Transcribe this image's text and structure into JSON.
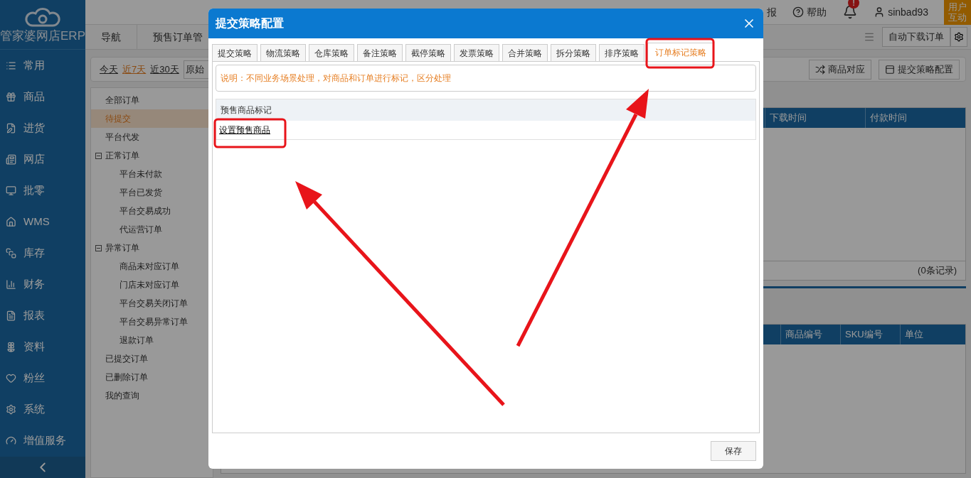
{
  "app": {
    "logo_text": "管家婆网店ERP"
  },
  "sidebar": {
    "items": [
      {
        "label": "常用"
      },
      {
        "label": "商品"
      },
      {
        "label": "进货"
      },
      {
        "label": "网店"
      },
      {
        "label": "批零"
      },
      {
        "label": "WMS"
      },
      {
        "label": "库存"
      },
      {
        "label": "财务"
      },
      {
        "label": "报表"
      },
      {
        "label": "资料"
      },
      {
        "label": "粉丝"
      },
      {
        "label": "系统"
      },
      {
        "label": "增值服务"
      }
    ]
  },
  "top_bar": {
    "partial_text": "报",
    "help": "帮助",
    "notification_badge": "!",
    "username": "sinbad93",
    "user_interact": "用户互动"
  },
  "nav_tabs": [
    {
      "label": "导航"
    },
    {
      "label": "预售订单管"
    }
  ],
  "toolbar": {
    "button": "自动下载订单"
  },
  "date_filters": [
    {
      "label": "今天",
      "selected": false
    },
    {
      "label": "近7天",
      "selected": true
    },
    {
      "label": "近30天",
      "selected": false
    }
  ],
  "filter_select": {
    "value": "原始"
  },
  "action_buttons": [
    "商品对应",
    "提交策略配置"
  ],
  "tree": [
    {
      "label": "全部订单",
      "selected": false
    },
    {
      "label": "待提交",
      "selected": true
    },
    {
      "label": "平台代发",
      "selected": false
    },
    {
      "label": "正常订单",
      "selected": false,
      "expanded": true,
      "children": [
        {
          "label": "平台未付款",
          "selected": false
        },
        {
          "label": "平台已发货",
          "selected": false
        },
        {
          "label": "平台交易成功",
          "selected": false
        },
        {
          "label": "代运营订单",
          "selected": false
        }
      ]
    },
    {
      "label": "异常订单",
      "selected": false,
      "expanded": true,
      "children": [
        {
          "label": "商品未对应订单",
          "selected": false
        },
        {
          "label": "门店未对应订单",
          "selected": false
        },
        {
          "label": "平台交易关闭订单",
          "selected": false
        },
        {
          "label": "平台交易异常订单",
          "selected": false
        },
        {
          "label": "退款订单",
          "selected": false
        }
      ]
    },
    {
      "label": "已提交订单",
      "selected": false
    },
    {
      "label": "已删除订单",
      "selected": false
    },
    {
      "label": "我的查询",
      "selected": false
    }
  ],
  "orders_table": {
    "columns": [
      "下载时间",
      "付款时间"
    ],
    "footer": "(0条记录)"
  },
  "detail_table": {
    "columns": [
      "商品编号",
      "SKU编号",
      "单位"
    ]
  },
  "dialog": {
    "title": "提交策略配置",
    "tabs": [
      {
        "label": "提交策略",
        "selected": false
      },
      {
        "label": "物流策略",
        "selected": false
      },
      {
        "label": "仓库策略",
        "selected": false
      },
      {
        "label": "备注策略",
        "selected": false
      },
      {
        "label": "截停策略",
        "selected": false
      },
      {
        "label": "发票策略",
        "selected": false
      },
      {
        "label": "合并策略",
        "selected": false
      },
      {
        "label": "拆分策略",
        "selected": false
      },
      {
        "label": "排序策略",
        "selected": false
      },
      {
        "label": "订单标记策略",
        "selected": true
      }
    ],
    "note": "说明：不同业务场景处理，对商品和订单进行标记，区分处理",
    "section_title": "预售商品标记",
    "link": "设置预售商品",
    "save_button": "保存"
  }
}
